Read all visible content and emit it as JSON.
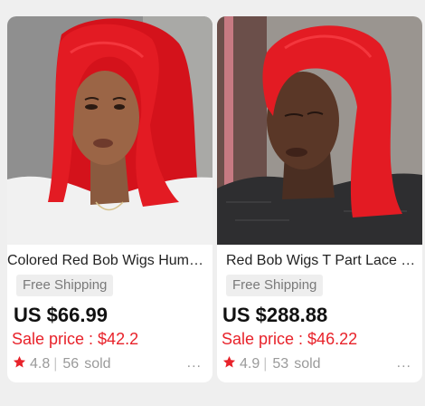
{
  "products": [
    {
      "title": "Colored Red Bob Wigs Human ...",
      "shipping": "Free Shipping",
      "price": "US $66.99",
      "sale": "Sale price : $42.2",
      "rating": "4.8",
      "separator": "|",
      "sold_count": "56",
      "sold_label": "sold",
      "more": "..."
    },
    {
      "title": "Red Bob Wigs T Part Lace Bo...",
      "shipping": "Free Shipping",
      "price": "US $288.88",
      "sale": "Sale price : $46.22",
      "rating": "4.9",
      "separator": "|",
      "sold_count": "53",
      "sold_label": "sold",
      "more": "..."
    }
  ],
  "colors": {
    "sale": "#e8222a",
    "star": "#e8222a",
    "wig": "#e31b23",
    "background": "#efefef"
  },
  "icons": {
    "rating": "star-icon",
    "more": "more-dots-icon"
  }
}
